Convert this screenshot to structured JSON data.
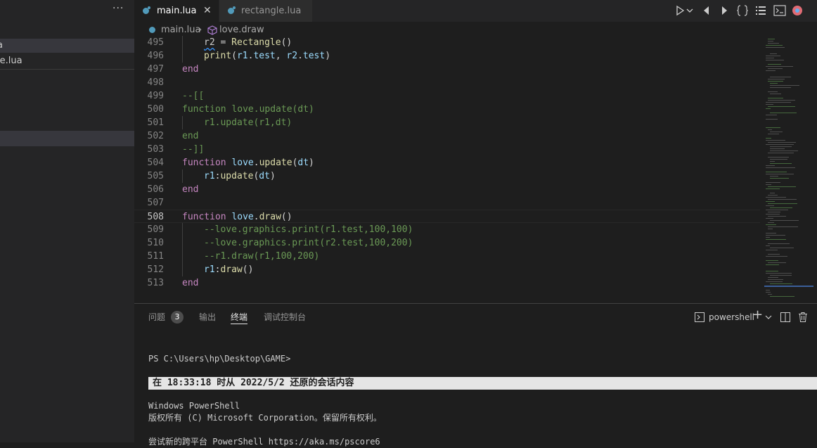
{
  "sidebar": {
    "more_label": "···",
    "files": [
      {
        "label": "a"
      },
      {
        "label": "le.lua"
      }
    ]
  },
  "tabs": [
    {
      "label": "main.lua",
      "active": true,
      "close": "✕"
    },
    {
      "label": "rectangle.lua",
      "active": false
    }
  ],
  "breadcrumb": {
    "file": "main.lua",
    "separator": "›",
    "symbol": "love.draw"
  },
  "toolbar_icons": [
    "run-icon",
    "chevron-down-icon",
    "go-back-icon",
    "go-forward-icon",
    "braces-icon",
    "list-icon",
    "terminal-icon",
    "color-icon"
  ],
  "editor": {
    "lines": [
      {
        "n": "495",
        "indent": 1,
        "tokens": [
          [
            "sq",
            "r2"
          ],
          [
            "pl",
            " = "
          ],
          [
            "fn",
            "Rectangle"
          ],
          [
            "pl",
            "()"
          ]
        ]
      },
      {
        "n": "496",
        "indent": 1,
        "tokens": [
          [
            "fn",
            "print"
          ],
          [
            "pl",
            "("
          ],
          [
            "vr",
            "r1"
          ],
          [
            "pl",
            "."
          ],
          [
            "vr",
            "test"
          ],
          [
            "pl",
            ", "
          ],
          [
            "vr",
            "r2"
          ],
          [
            "pl",
            "."
          ],
          [
            "vr",
            "test"
          ],
          [
            "pl",
            ")"
          ]
        ]
      },
      {
        "n": "497",
        "indent": 0,
        "tokens": [
          [
            "kw",
            "end"
          ]
        ]
      },
      {
        "n": "498",
        "indent": 0,
        "tokens": []
      },
      {
        "n": "499",
        "indent": 0,
        "tokens": [
          [
            "cm",
            "--[["
          ]
        ]
      },
      {
        "n": "500",
        "indent": 0,
        "tokens": [
          [
            "cm",
            "function love.update(dt)"
          ]
        ]
      },
      {
        "n": "501",
        "indent": 1,
        "tokens": [
          [
            "cm",
            "r1.update(r1,dt)"
          ]
        ]
      },
      {
        "n": "502",
        "indent": 0,
        "tokens": [
          [
            "cm",
            "end"
          ]
        ]
      },
      {
        "n": "503",
        "indent": 0,
        "tokens": [
          [
            "cm",
            "--]]"
          ]
        ]
      },
      {
        "n": "504",
        "indent": 0,
        "tokens": [
          [
            "kw",
            "function "
          ],
          [
            "vr",
            "love"
          ],
          [
            "pl",
            "."
          ],
          [
            "fn",
            "update"
          ],
          [
            "pl",
            "("
          ],
          [
            "vr",
            "dt"
          ],
          [
            "pl",
            ")"
          ]
        ]
      },
      {
        "n": "505",
        "indent": 1,
        "tokens": [
          [
            "vr",
            "r1"
          ],
          [
            "pl",
            ":"
          ],
          [
            "fn",
            "update"
          ],
          [
            "pl",
            "("
          ],
          [
            "vr",
            "dt"
          ],
          [
            "pl",
            ")"
          ]
        ]
      },
      {
        "n": "506",
        "indent": 0,
        "tokens": [
          [
            "kw",
            "end"
          ]
        ]
      },
      {
        "n": "507",
        "indent": 0,
        "tokens": []
      },
      {
        "n": "508",
        "indent": 0,
        "current": true,
        "tokens": [
          [
            "kw",
            "function "
          ],
          [
            "vr",
            "love"
          ],
          [
            "pl",
            "."
          ],
          [
            "fn",
            "draw"
          ],
          [
            "pl",
            "()"
          ]
        ]
      },
      {
        "n": "509",
        "indent": 1,
        "tokens": [
          [
            "cm",
            "--love.graphics.print(r1.test,100,100)"
          ]
        ]
      },
      {
        "n": "510",
        "indent": 1,
        "tokens": [
          [
            "cm",
            "--love.graphics.print(r2.test,100,200)"
          ]
        ]
      },
      {
        "n": "511",
        "indent": 1,
        "tokens": [
          [
            "cm",
            "--r1.draw(r1,100,200)"
          ]
        ]
      },
      {
        "n": "512",
        "indent": 1,
        "tokens": [
          [
            "vr",
            "r1"
          ],
          [
            "pl",
            ":"
          ],
          [
            "fn",
            "draw"
          ],
          [
            "pl",
            "()"
          ]
        ]
      },
      {
        "n": "513",
        "indent": 0,
        "tokens": [
          [
            "kw",
            "end"
          ]
        ]
      }
    ]
  },
  "panel": {
    "tabs": [
      {
        "label": "问题",
        "badge": "3"
      },
      {
        "label": "输出"
      },
      {
        "label": "终端",
        "active": true
      },
      {
        "label": "调试控制台"
      }
    ],
    "terminal_name": "powershell",
    "add_label": "+",
    "terminal_lines": {
      "prompt": "PS C:\\Users\\hp\\Desktop\\GAME>",
      "restored": "在 18:33:18 时从 2022/5/2 还原的会话内容",
      "ps_title": "Windows PowerShell",
      "copyright": "版权所有 (C) Microsoft Corporation。保留所有权利。",
      "cut_line": "尝试新的跨平台 PowerShell https://aka.ms/pscore6"
    }
  }
}
